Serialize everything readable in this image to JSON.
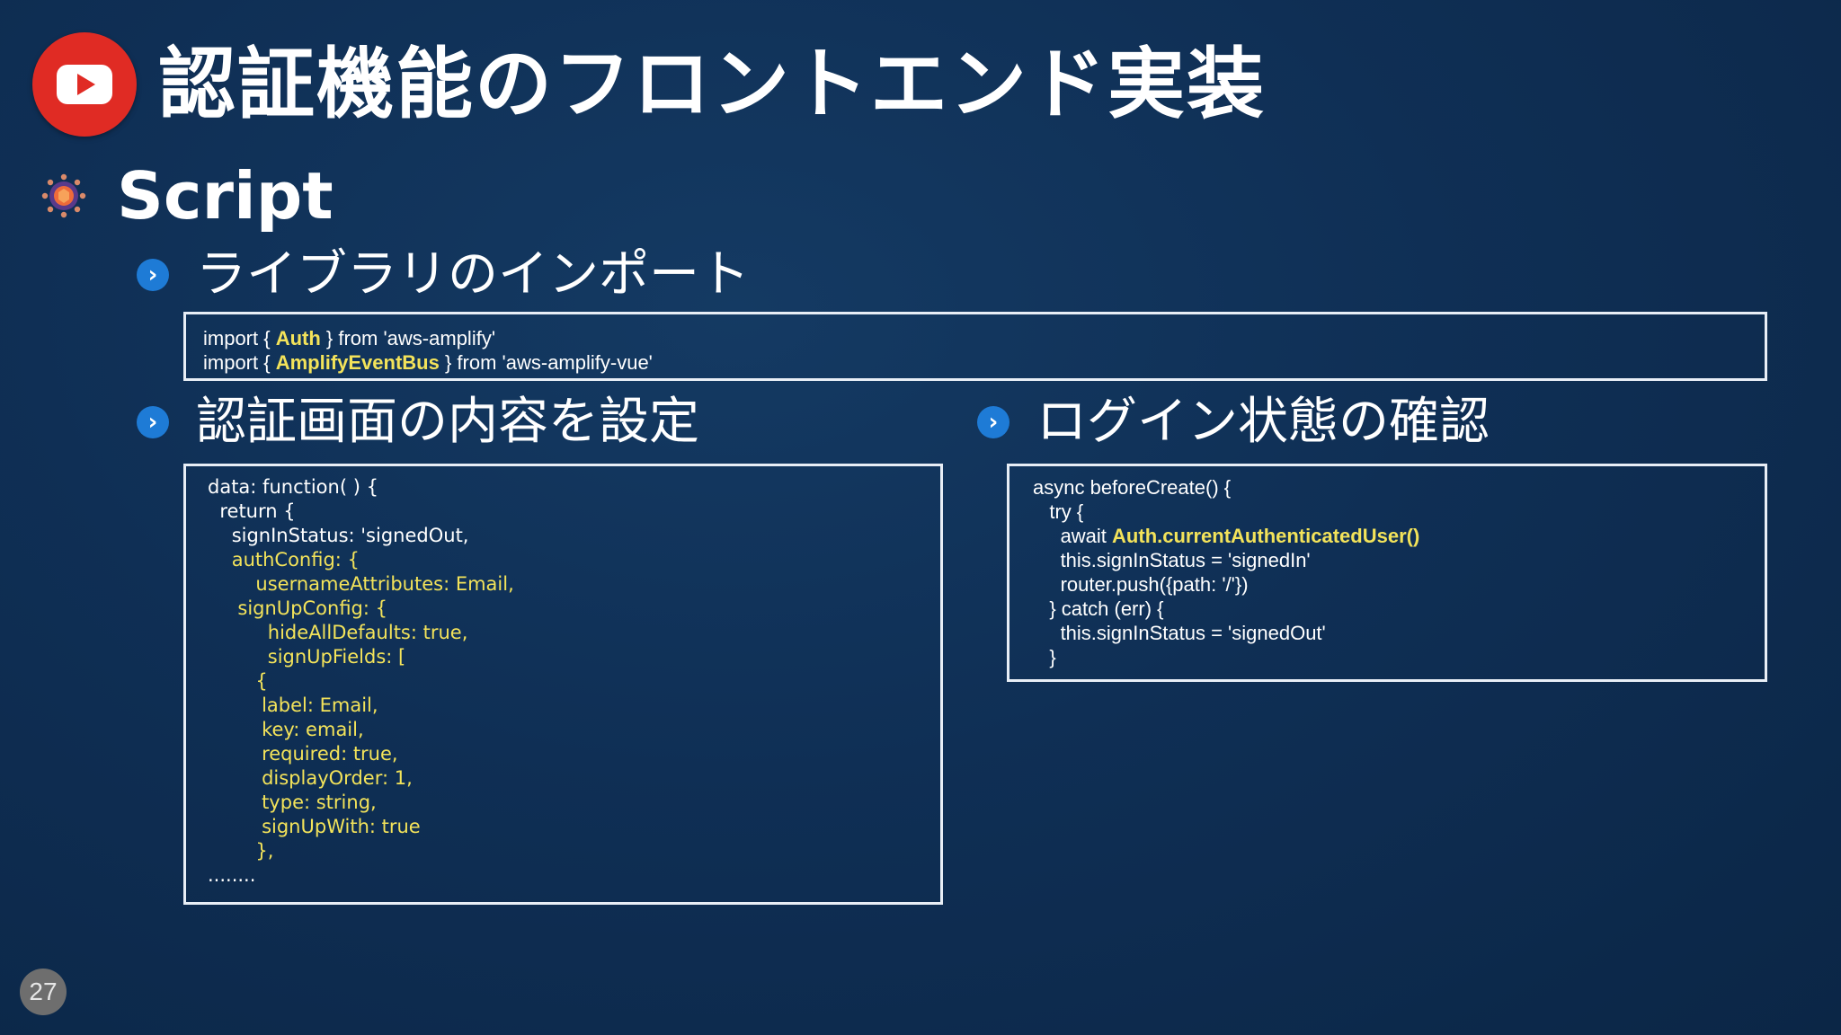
{
  "header": {
    "title": "認証機能のフロントエンド実装",
    "logo_icon": "youtube-play-icon"
  },
  "section": {
    "title": "Script",
    "icon": "gear-icon"
  },
  "subsections": [
    {
      "title": "ライブラリのインポート",
      "bullet": "›"
    },
    {
      "title": "認証画面の内容を設定",
      "bullet": "›"
    },
    {
      "title": "ログイン状態の確認",
      "bullet": "›"
    }
  ],
  "import_code": {
    "line1": {
      "a": "import { ",
      "b": "Auth",
      "c": " } from 'aws-amplify'"
    },
    "line2": {
      "a": "import { ",
      "b": "AmplifyEventBus",
      "c": " } from 'aws-amplify-vue'"
    }
  },
  "config_code": [
    {
      "indent": "",
      "white": "data: function( ) {",
      "yellow": ""
    },
    {
      "indent": "  ",
      "white": "return {",
      "yellow": ""
    },
    {
      "indent": "    ",
      "white": "signInStatus: 'signedOut,",
      "yellow": ""
    },
    {
      "indent": "    ",
      "white": "",
      "yellow": "authConfig: {"
    },
    {
      "indent": "        ",
      "white": "",
      "yellow": "usernameAttributes: Email,"
    },
    {
      "indent": "     ",
      "white": "",
      "yellow": "signUpConfig: {"
    },
    {
      "indent": "          ",
      "white": "",
      "yellow": "hideAllDefaults: true,"
    },
    {
      "indent": "          ",
      "white": "",
      "yellow": "signUpFields: ["
    },
    {
      "indent": "        ",
      "white": "",
      "yellow": "{"
    },
    {
      "indent": "         ",
      "white": "",
      "yellow": "label: Email,"
    },
    {
      "indent": "         ",
      "white": "",
      "yellow": "key: email,"
    },
    {
      "indent": "         ",
      "white": "",
      "yellow": "required: true,"
    },
    {
      "indent": "         ",
      "white": "",
      "yellow": "displayOrder: 1,"
    },
    {
      "indent": "         ",
      "white": "",
      "yellow": "type: string,"
    },
    {
      "indent": "         ",
      "white": "",
      "yellow": "signUpWith: true"
    },
    {
      "indent": "        ",
      "white": "",
      "yellow": "},"
    },
    {
      "indent": "",
      "white": "........",
      "yellow": ""
    }
  ],
  "login_code": [
    {
      "indent": "",
      "white": "async beforeCreate() {",
      "yellow": "",
      "tail": ""
    },
    {
      "indent": "   ",
      "white": "try {",
      "yellow": "",
      "tail": ""
    },
    {
      "indent": "     ",
      "white": "await ",
      "yellow": "Auth.currentAuthenticatedUser()",
      "tail": ""
    },
    {
      "indent": "     ",
      "white": "this.signInStatus = 'signedIn'",
      "yellow": "",
      "tail": ""
    },
    {
      "indent": "     ",
      "white": "router.push({path: '/'})",
      "yellow": "",
      "tail": ""
    },
    {
      "indent": "   ",
      "white": "} catch (err) {",
      "yellow": "",
      "tail": ""
    },
    {
      "indent": "     ",
      "white": "this.signInStatus = 'signedOut'",
      "yellow": "",
      "tail": ""
    },
    {
      "indent": "   ",
      "white": "}",
      "yellow": "",
      "tail": ""
    }
  ],
  "footer": {
    "page_number": "27"
  },
  "colors": {
    "background": "#0f2f55",
    "highlight": "#f3e35a",
    "bullet": "#1e7bd6",
    "logo_red": "#e02b24",
    "page_badge": "#6e6e6e"
  }
}
